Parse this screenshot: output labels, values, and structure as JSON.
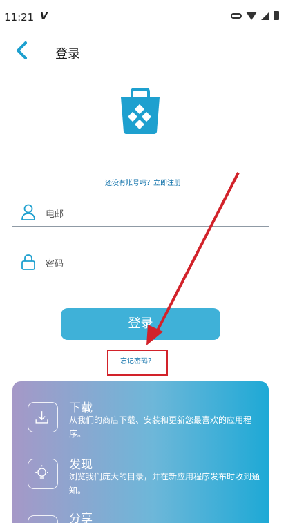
{
  "status_bar": {
    "time": "11:21",
    "carrier_glyph": "V"
  },
  "header": {
    "title": "登录"
  },
  "register_link": "还没有账号吗？立即注册",
  "email_field": {
    "placeholder": "电邮"
  },
  "password_field": {
    "placeholder": "密码"
  },
  "login_button": "登录",
  "forgot_password_link": "忘记密码？",
  "features": [
    {
      "title": "下载",
      "description": "从我们的商店下载、安装和更新您最喜欢的应用程序。",
      "icon": "download-icon"
    },
    {
      "title": "发现",
      "description": "浏览我们庞大的目录，并在新应用程序发布时收到通知。",
      "icon": "bulb-icon"
    },
    {
      "title": "分享",
      "description": "",
      "icon": "share-icon"
    }
  ],
  "colors": {
    "accent": "#3fb1d8",
    "annotation": "#d2222a",
    "link": "#0a6ea8"
  }
}
